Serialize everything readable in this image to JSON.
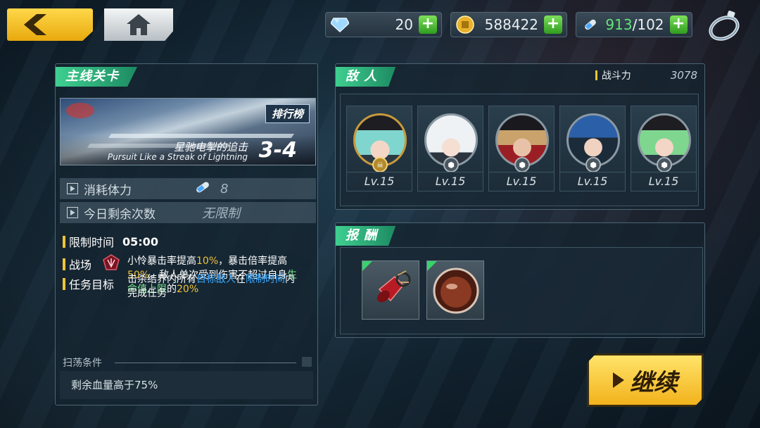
{
  "topbar": {
    "resources": {
      "gems": "20",
      "coins": "588422",
      "stamina_current": "913",
      "stamina_max": "/102"
    }
  },
  "stage_panel": {
    "title": "主线关卡",
    "rank_label": "排行榜",
    "stage_name_cn": "星驰电掣的追击",
    "stage_name_en": "Pursuit Like a Streak of Lightning",
    "stage_number": "3-4",
    "cost_label": "消耗体力",
    "cost_value": "8",
    "remaining_label": "今日剩余次数",
    "remaining_value": "无限制",
    "time_label": "限制时间",
    "time_value": "05:00",
    "battlefield_label": "战场",
    "battlefield_text_a": "小怜暴击率提高",
    "battlefield_pct_a": "10%",
    "battlefield_text_b": "，暴击倍率提高",
    "battlefield_pct_b": "50%",
    "battlefield_text_c": "，敌人单次受到伤害不超过自身",
    "battlefield_hl": "生命值上限",
    "battlefield_text_d": "的",
    "battlefield_pct_c": "20%",
    "goal_label": "任务目标",
    "goal_text_a": "击杀结界内所有",
    "goal_hl_a": "目标敌人",
    "goal_text_b": "在",
    "goal_hl_b": "限制时间",
    "goal_text_c": "内完成任务",
    "sweep_label": "扫荡条件",
    "sweep_condition": "剩余血量高于75%"
  },
  "enemy_panel": {
    "title": "敌 人",
    "power_label": "战斗力",
    "power_value": "3078",
    "enemies": [
      {
        "level": "Lv.15"
      },
      {
        "level": "Lv.15"
      },
      {
        "level": "Lv.15"
      },
      {
        "level": "Lv.15"
      },
      {
        "level": "Lv.15"
      }
    ]
  },
  "reward_panel": {
    "title": "报 酬"
  },
  "continue_label": "继续",
  "colors": {
    "accent_green": "#3fcf90",
    "gold": "#f0c23a",
    "highlight_blue": "#39a8ff"
  }
}
